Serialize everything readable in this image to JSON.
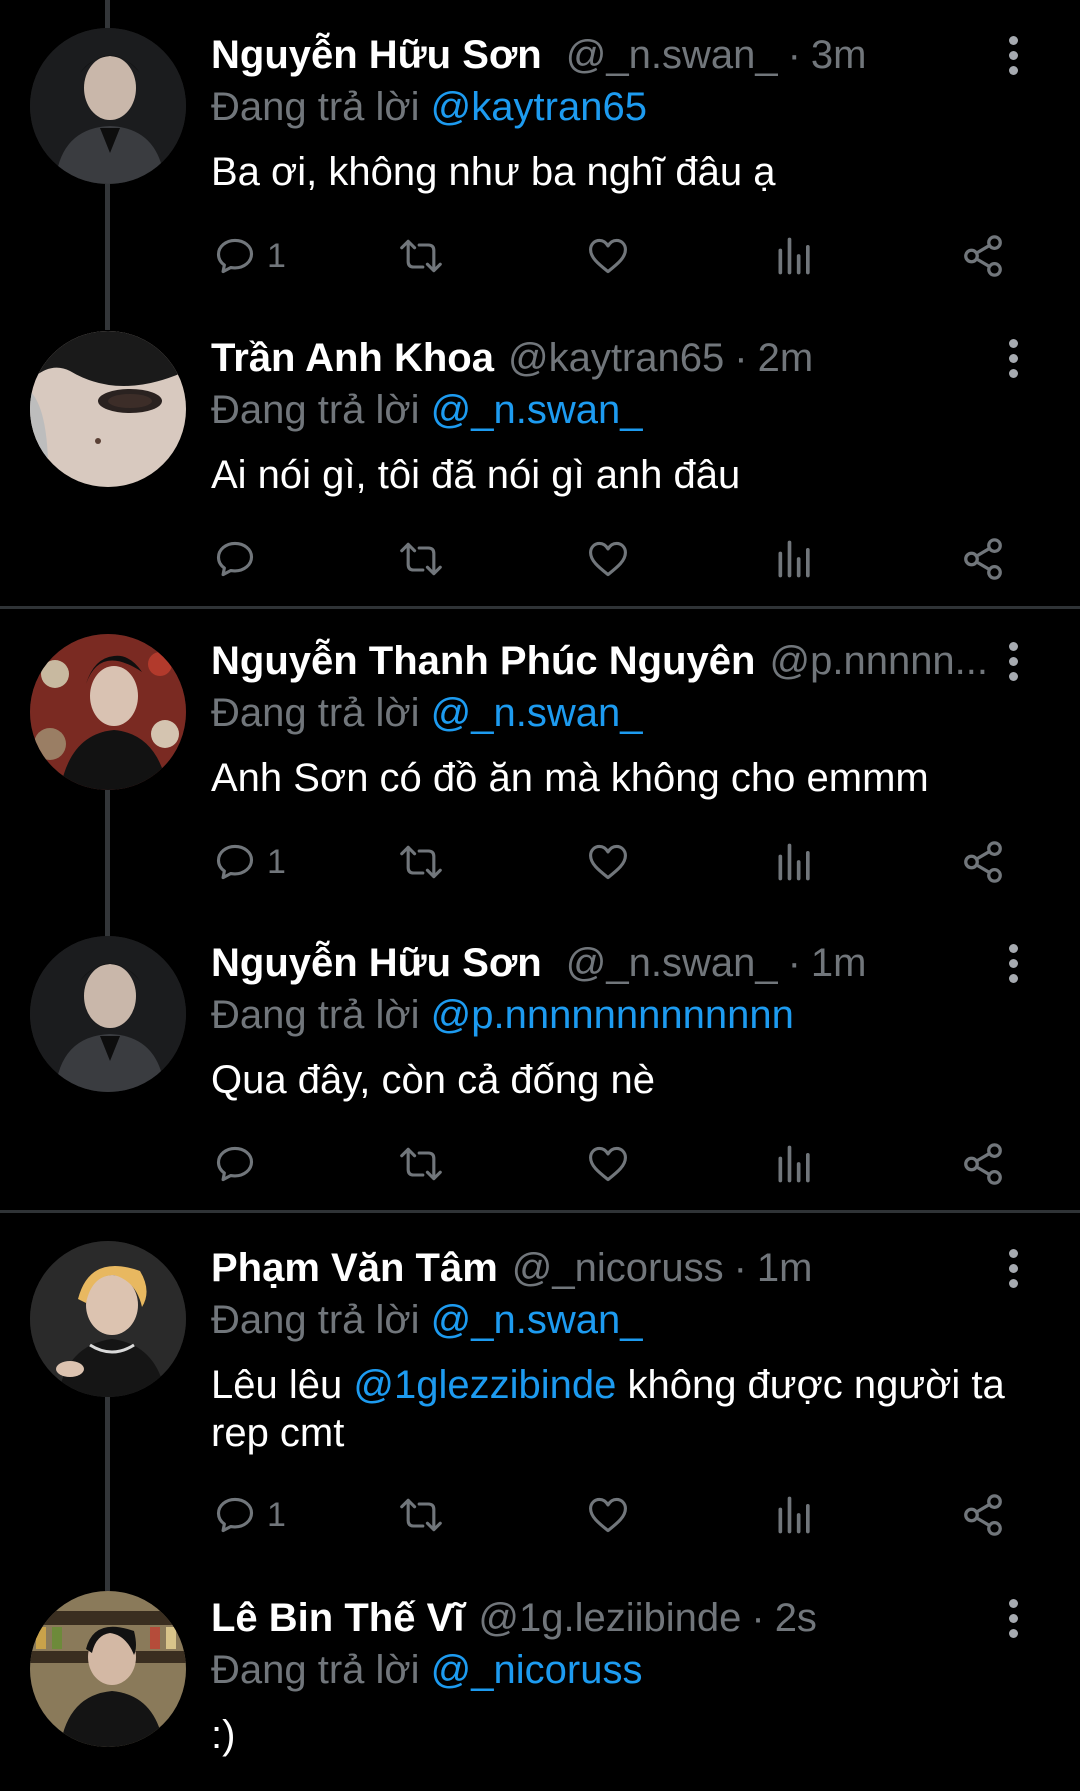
{
  "reply_prefix": "Đang trả lời",
  "tweets": [
    {
      "name": "Nguyễn Hữu Sơn",
      "handle": "@_n.swan_",
      "time": "3m",
      "reply_to": "@kaytran65",
      "text_before": "Ba ơi, không như ba nghĩ đâu ạ",
      "mention": "",
      "text_after": "",
      "replies": "1"
    },
    {
      "name": "Trần Anh Khoa",
      "handle": "@kaytran65",
      "time": "2m",
      "reply_to": "@_n.swan_",
      "text_before": "Ai nói gì, tôi đã nói gì anh đâu",
      "mention": "",
      "text_after": "",
      "replies": ""
    },
    {
      "name": "Nguyễn Thanh Phúc Nguyên",
      "handle": "@p.nnnnn...",
      "time": "",
      "reply_to": "@_n.swan_",
      "text_before": "Anh Sơn có đồ ăn mà không cho emmm",
      "mention": "",
      "text_after": "",
      "replies": "1"
    },
    {
      "name": "Nguyễn Hữu Sơn",
      "handle": "@_n.swan_",
      "time": "1m",
      "reply_to": "@p.nnnnnnnnnnnnn",
      "text_before": "Qua đây, còn cả đống nè",
      "mention": "",
      "text_after": "",
      "replies": ""
    },
    {
      "name": "Phạm Văn Tâm",
      "handle": "@_nicoruss",
      "time": "1m",
      "reply_to": "@_n.swan_",
      "text_before": "Lêu lêu ",
      "mention": "@1glezzibinde",
      "text_after": " không được người ta rep cmt",
      "replies": "1"
    },
    {
      "name": "Lê Bin Thế Vĩ",
      "handle": "@1g.leziibinde",
      "time": "2s",
      "reply_to": "@_nicoruss",
      "text_before": ":)",
      "mention": "",
      "text_after": "",
      "replies": ""
    }
  ],
  "icons": {
    "reply": "speech-bubble-icon",
    "retweet": "retweet-icon",
    "like": "heart-icon",
    "views": "bar-chart-icon",
    "share": "share-icon",
    "more": "vertical-dots-icon"
  },
  "colors": {
    "background": "#000000",
    "text": "#ffffff",
    "muted": "#71767b",
    "link": "#1d9bf0",
    "divider": "#2f3336",
    "thread_line": "#333639"
  }
}
